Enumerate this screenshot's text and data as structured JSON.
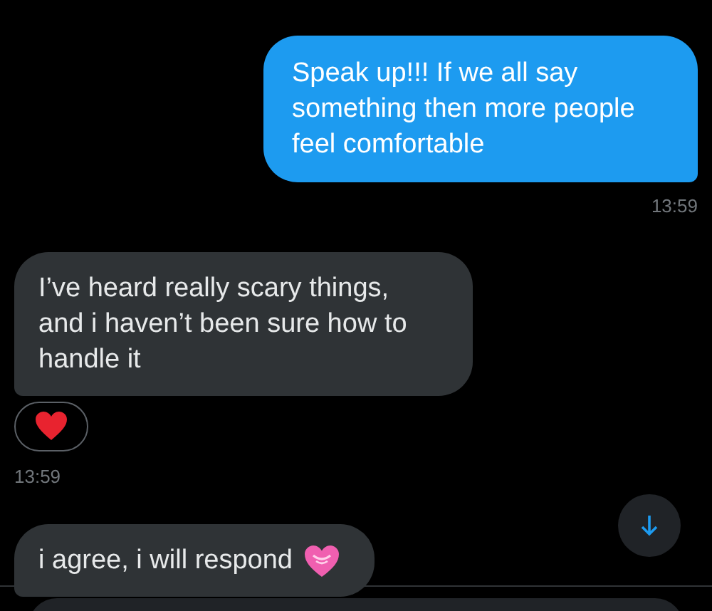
{
  "messages": [
    {
      "kind": "outgoing",
      "text": "Speak up!!! If we all say something then more people feel comfortable",
      "time": "13:59",
      "reacted": false,
      "trailing_heart": false
    },
    {
      "kind": "incoming",
      "text": "I’ve heard really scary things, and i haven’t been sure how to handle it",
      "time": "13:59",
      "reacted": true,
      "trailing_heart": false
    },
    {
      "kind": "incoming",
      "text": "i agree, i will respond",
      "reacted": false,
      "trailing_heart": true
    }
  ]
}
